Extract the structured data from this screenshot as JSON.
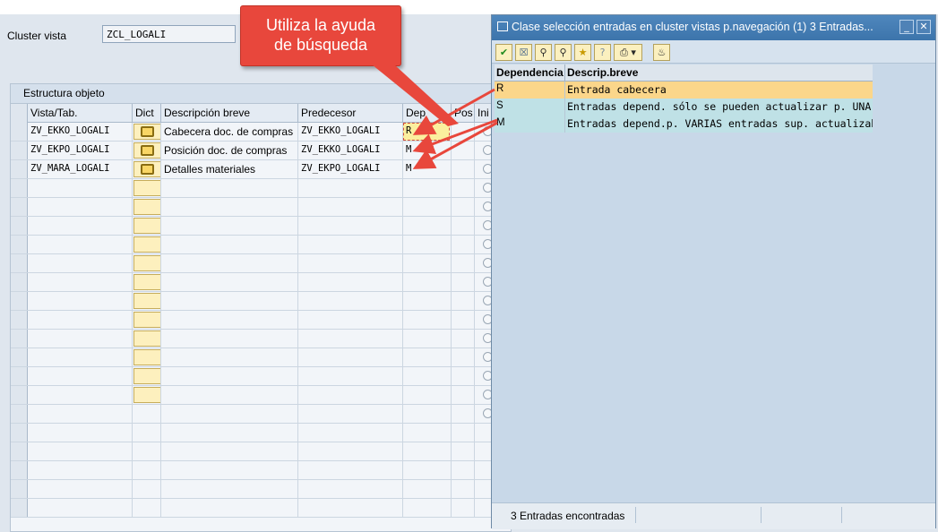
{
  "cluster": {
    "label": "Cluster vista",
    "value": "ZCL_LOGALI"
  },
  "panel": {
    "title": "Estructura objeto"
  },
  "table": {
    "columns": [
      "Vista/Tab.",
      "Dict",
      "Descripción breve",
      "Predecesor",
      "Dep",
      "Pos",
      "Ini"
    ],
    "rows": [
      {
        "vista": "ZV_EKKO_LOGALI",
        "desc": "Cabecera doc. de compras",
        "pred": "ZV_EKKO_LOGALI",
        "dep": "R"
      },
      {
        "vista": "ZV_EKPO_LOGALI",
        "desc": "Posición doc. de compras",
        "pred": "ZV_EKKO_LOGALI",
        "dep": "M"
      },
      {
        "vista": "ZV_MARA_LOGALI",
        "desc": "Detalles materiales",
        "pred": "ZV_EKPO_LOGALI",
        "dep": "M"
      }
    ]
  },
  "callout": {
    "line1": "Utiliza la ayuda",
    "line2": "de búsqueda"
  },
  "dialog": {
    "title": "Clase selección entradas en cluster vistas p.navegación (1)    3 Entradas...",
    "columns": [
      "Dependencia",
      "Descrip.breve"
    ],
    "rows": [
      {
        "code": "R",
        "text": "Entrada cabecera"
      },
      {
        "code": "S",
        "text": "Entradas depend. sólo se pueden actualizar p. UNA entr.sup."
      },
      {
        "code": "M",
        "text": "Entradas depend.p. VARIAS entradas sup. actualizables conj."
      }
    ],
    "status": "3 Entradas encontradas"
  },
  "colors": {
    "accent": "#e8473c",
    "selected_row": "#fbd68a",
    "alt_row": "#bfe1e6",
    "title_bar": "#4f87bd"
  }
}
